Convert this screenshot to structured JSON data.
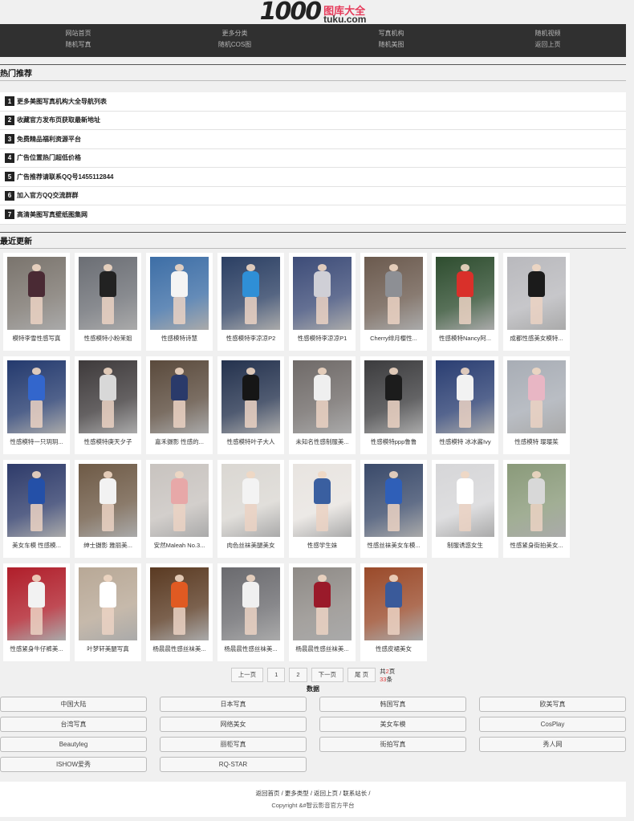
{
  "logo": {
    "text": "1000",
    "cn": "图库大全",
    "site": "tuku.com"
  },
  "nav": {
    "cols": [
      {
        "top": "网站首页",
        "bottom": "随机写真"
      },
      {
        "top": "更多分类",
        "bottom": "随机COS图"
      },
      {
        "top": "写真机构",
        "bottom": "随机美图"
      },
      {
        "top": "随机视频",
        "bottom": "返回上页"
      }
    ]
  },
  "hot": {
    "title": "热门推荐",
    "items": [
      {
        "num": "1",
        "text": "更多美图写真机构大全导航列表"
      },
      {
        "num": "2",
        "text": "收藏官方发布页获取最新地址"
      },
      {
        "num": "3",
        "text": "免费精品福利资源平台"
      },
      {
        "num": "4",
        "text": "广告位置热门超低价格"
      },
      {
        "num": "5",
        "text": "广告推荐请联系QQ号1455112844"
      },
      {
        "num": "6",
        "text": "加入官方QQ交流群群"
      },
      {
        "num": "7",
        "text": "高清美图写真壁纸图集网"
      }
    ]
  },
  "recent": {
    "title": "最近更新",
    "cards": [
      {
        "caption": "模特李雪性感写真",
        "bg": "#7a746d",
        "cloth": "#4a2a34"
      },
      {
        "caption": "性感模特小粉茉姐",
        "bg": "#6b6e74",
        "cloth": "#222222"
      },
      {
        "caption": "性感模特诗慧",
        "bg": "#3d6ea6",
        "cloth": "#f4f4f4"
      },
      {
        "caption": "性感模特李凉凉P2",
        "bg": "#2b3f63",
        "cloth": "#2f8fd6"
      },
      {
        "caption": "性感模特李凉凉P1",
        "bg": "#3d4c78",
        "cloth": "#cfcfd6"
      },
      {
        "caption": "Cherry绯月樱性...",
        "bg": "#6b5a4e",
        "cloth": "#8d8f94"
      },
      {
        "caption": "性感模特Nancy阿...",
        "bg": "#2e4d2f",
        "cloth": "#d9302a"
      },
      {
        "caption": "成都性感美女模特...",
        "bg": "#b9b9bd",
        "cloth": "#1b1b1b"
      },
      {
        "caption": "性感模特一只玥玥...",
        "bg": "#243a6e",
        "cloth": "#3366cc"
      },
      {
        "caption": "性感模特庚天夕子",
        "bg": "#3e3a3b",
        "cloth": "#d8d8d8"
      },
      {
        "caption": "嘉禾摄影 性感的...",
        "bg": "#5a4a3c",
        "cloth": "#2a3a6a"
      },
      {
        "caption": "性感模特叶子大人",
        "bg": "#24324e",
        "cloth": "#161616"
      },
      {
        "caption": "未知名性感制服美...",
        "bg": "#6f6a68",
        "cloth": "#efefef"
      },
      {
        "caption": "性感模特ppp鲁鲁",
        "bg": "#3c3c3e",
        "cloth": "#1c1c1c"
      },
      {
        "caption": "性感模特 冰冰酱Ivy",
        "bg": "#2a3e72",
        "cloth": "#f2f2f2"
      },
      {
        "caption": "性感模特 璎璎茱",
        "bg": "#a8adb5",
        "cloth": "#e8b6c4"
      },
      {
        "caption": "美女车模 性感模...",
        "bg": "#2e3b6a",
        "cloth": "#2450a8"
      },
      {
        "caption": "绅士摄影 雅丽美...",
        "bg": "#6e5a46",
        "cloth": "#f2f2f2"
      },
      {
        "caption": "安然Maleah No.3...",
        "bg": "#c8c3bf",
        "cloth": "#e7a8a8"
      },
      {
        "caption": "肉色丝袜美腿美女",
        "bg": "#dad7d2",
        "cloth": "#f3f3f3"
      },
      {
        "caption": "性感学生妹",
        "bg": "#e8e4e0",
        "cloth": "#3a5fa0"
      },
      {
        "caption": "性感丝袜美女车模...",
        "bg": "#3a4a6a",
        "cloth": "#2f5fb8"
      },
      {
        "caption": "制服诱惑女生",
        "bg": "#d6d6d8",
        "cloth": "#ffffff"
      },
      {
        "caption": "性感紧身街拍美女...",
        "bg": "#8a9a7a",
        "cloth": "#d8d8d8"
      },
      {
        "caption": "性感紧身牛仔裤美...",
        "bg": "#b01e2a",
        "cloth": "#f2f2f2"
      },
      {
        "caption": "叶梦轩美腿写真",
        "bg": "#b8a896",
        "cloth": "#ffffff"
      },
      {
        "caption": "杨晨晨性感丝袜美...",
        "bg": "#5a3a22",
        "cloth": "#e05a22"
      },
      {
        "caption": "杨晨晨性感丝袜美...",
        "bg": "#6a6a6e",
        "cloth": "#f0f0f0"
      },
      {
        "caption": "杨晨晨性感丝袜美...",
        "bg": "#8e8a86",
        "cloth": "#9a1a2a"
      },
      {
        "caption": "性感皮裙美女",
        "bg": "#9a4a2a",
        "cloth": "#3a5a9a"
      }
    ]
  },
  "pager": {
    "prev": "上一页",
    "p1": "1",
    "p2": "2",
    "next": "下一页",
    "last": "尾 页",
    "info_prefix": "共",
    "pages": "2",
    "info_pages_suffix": "页",
    "count": "33",
    "info_count_suffix": "条",
    "data_label": "数据"
  },
  "categories": [
    "中国大陆",
    "日本写真",
    "韩国写真",
    "欧美写真",
    "台湾写真",
    "网络美女",
    "美女车模",
    "CosPlay",
    "Beautyleg",
    "丽柜写真",
    "街拍写真",
    "秀人网",
    "ISHOW爱秀",
    "RQ-STAR"
  ],
  "footer": {
    "links": "返回首页 / 更多类型 / 返回上页 / 联系站长 /",
    "copyright": "Copyright &#智云影音官方平台"
  }
}
